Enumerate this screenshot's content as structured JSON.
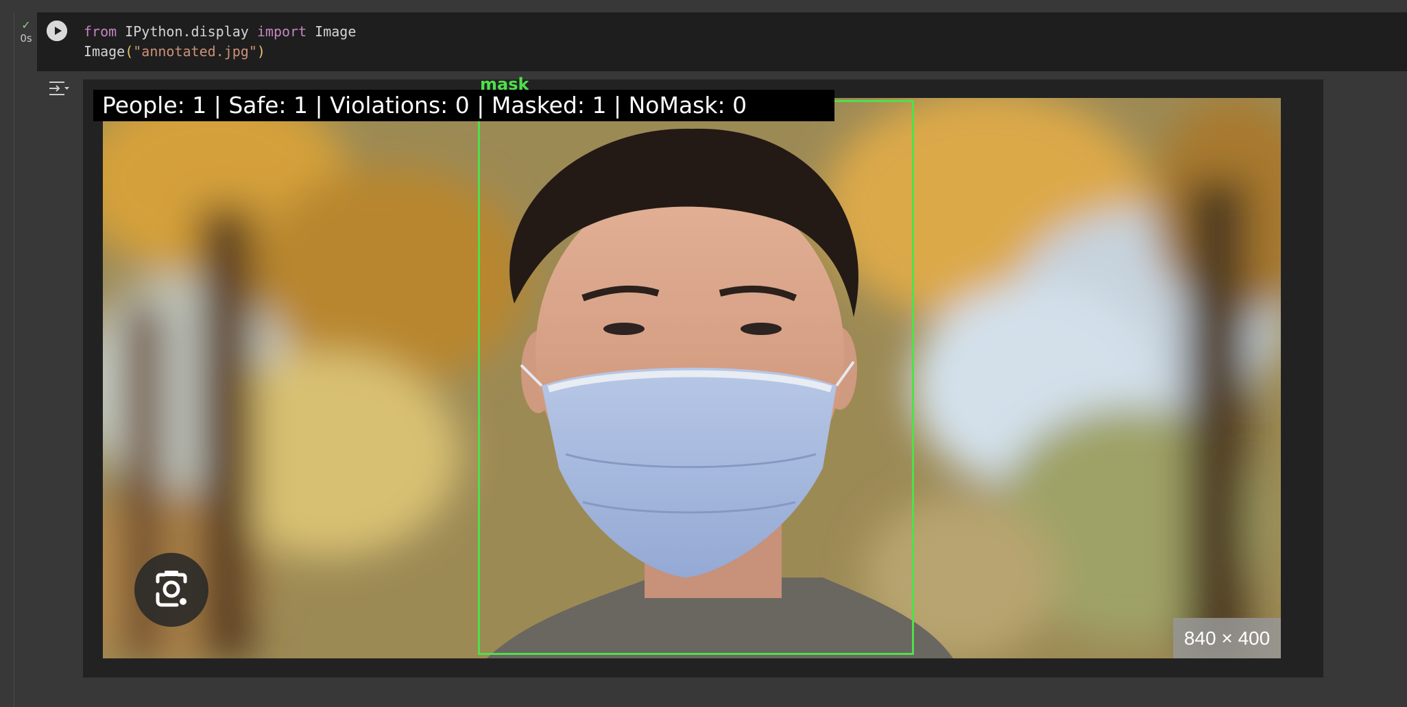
{
  "cell": {
    "status_icon": "check-icon",
    "exec_time": "0s",
    "code": {
      "line1": {
        "kw_from": "from",
        "module": " IPython.display ",
        "kw_import": "import",
        "name": " Image"
      },
      "line2": {
        "func": "Image",
        "open_paren": "(",
        "arg": "\"annotated.jpg\"",
        "close_paren": ")"
      }
    }
  },
  "output": {
    "menu_icon": "output-collapse-icon",
    "image": {
      "detection_label": "mask",
      "summary": "People: 1 | Safe: 1 | Violations: 0 | Masked: 1 | NoMask: 0",
      "dimensions": "840 × 400",
      "box_color": "#4fe04a"
    },
    "lens_icon": "google-lens-icon"
  }
}
